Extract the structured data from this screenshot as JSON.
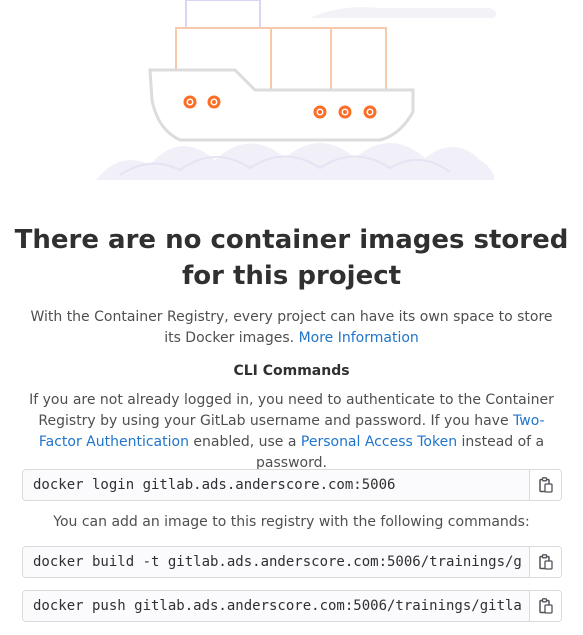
{
  "empty_state": {
    "title": "There are no container images stored for this project",
    "description": "With the Container Registry, every project can have its own space to store its Docker images.",
    "more_info_link": "More Information"
  },
  "cli": {
    "heading": "CLI Commands",
    "login_intro_1": "If you are not already logged in, you need to authenticate to the Container Registry by using your GitLab username and password. If you have ",
    "two_factor_link": "Two-Factor Authentication",
    "login_intro_2": " enabled, use a ",
    "pat_link": "Personal Access Token",
    "login_intro_3": " instead of a password.",
    "login_command": "docker login gitlab.ads.anderscore.com:5006",
    "add_image_text": "You can add an image to this registry with the following commands:",
    "build_command": "docker build -t gitlab.ads.anderscore.com:5006/trainings/g",
    "push_command": "docker push gitlab.ads.anderscore.com:5006/trainings/gitla",
    "copy_icon": "clipboard-icon"
  },
  "colors": {
    "link": "#1f75cb",
    "ship_outline": "#dcdcde",
    "ship_accent": "#fc6d26",
    "container_outline": "#f5c9a9",
    "wave": "#ece8f5"
  }
}
